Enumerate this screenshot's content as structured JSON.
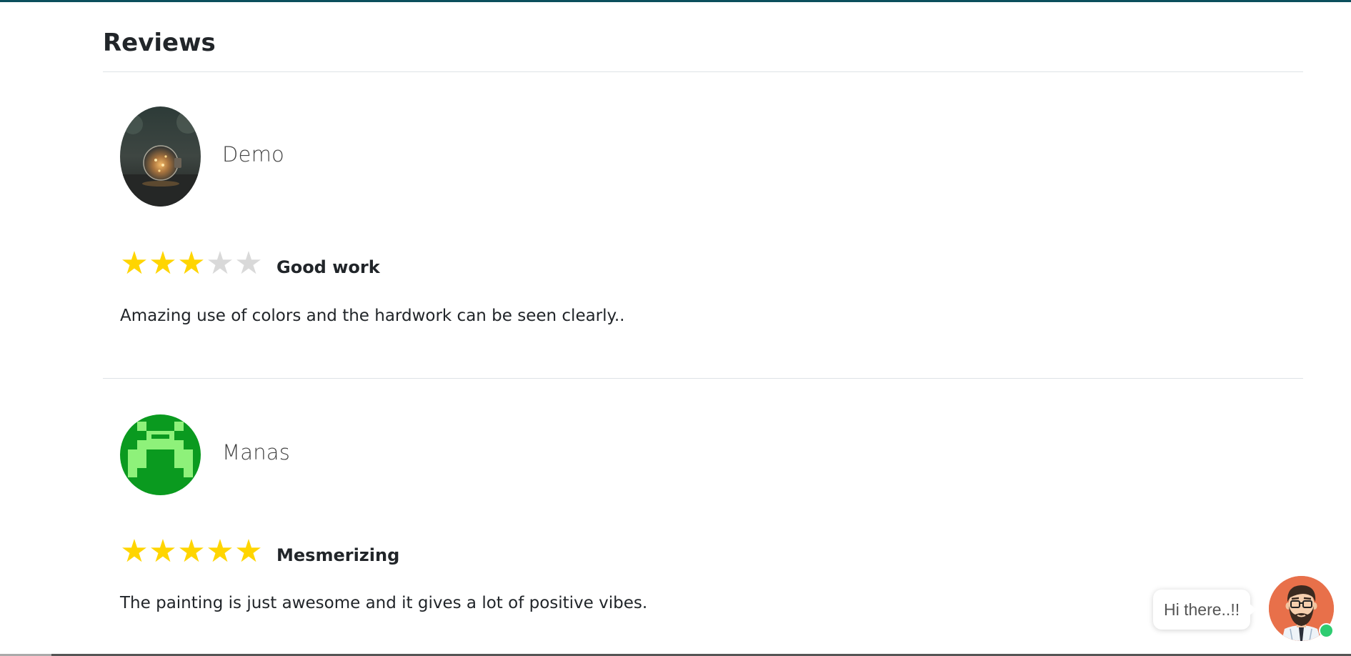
{
  "section": {
    "title": "Reviews"
  },
  "reviews": [
    {
      "reviewer": "Demo",
      "avatar_icon": "lightbulb-photo",
      "rating": 3,
      "rating_max": 5,
      "title": "Good work",
      "body": "Amazing use of colors and the hardwork can be seen clearly.."
    },
    {
      "reviewer": "Manas",
      "avatar_icon": "green-identicon",
      "rating": 5,
      "rating_max": 5,
      "title": "Mesmerizing",
      "body": "The painting is just awesome and it gives a lot of positive vibes."
    }
  ],
  "chat": {
    "greeting": "Hi there..!!",
    "avatar_icon": "bearded-man-avatar",
    "status": "online"
  },
  "colors": {
    "star_filled": "#ffd500",
    "star_empty": "#d9d9d9",
    "accent_top": "#0b4f5c",
    "identicon_dark": "#0a9a1f",
    "identicon_light": "#8ef17a",
    "online": "#2ecc71",
    "chat_avatar_bg": "#e8704a"
  }
}
